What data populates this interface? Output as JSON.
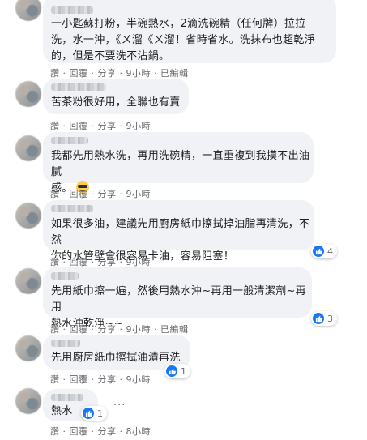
{
  "comments": [
    {
      "text": "一小匙蘇打粉，半碗熱水，2滴洗碗精（任何牌）拉拉\n洗，水一沖，《ㄨ溜《ㄨ溜！省時省水。洗抹布也超乾淨\n的，但是不要洗不沾鍋。",
      "actions": {
        "like": "讚",
        "reply": "回覆",
        "share": "分享",
        "time": "9小時",
        "edited": "已編輯"
      }
    },
    {
      "text": "苦茶粉很好用，全聯也有賣",
      "actions": {
        "like": "讚",
        "reply": "回覆",
        "share": "分享",
        "time": "9小時"
      }
    },
    {
      "text": "我都先用熱水洗，再用洗碗精，一直重複到我摸不出油膩\n感。",
      "emoji": "sunglasses-emoji",
      "actions": {
        "like": "讚",
        "reply": "回覆",
        "share": "分享",
        "time": "9小時"
      }
    },
    {
      "text": "如果很多油，建議先用廚房紙巾擦拭掉油脂再清洗，不然\n你的水管壁會很容易卡油，容易阻塞！",
      "reaction_count": "4",
      "actions": {
        "like": "讚",
        "reply": "回覆",
        "share": "分享",
        "time": "9小時"
      }
    },
    {
      "text": "先用紙巾擦一遍，然後用熱水沖~再用一般清潔劑~再用\n熱水沖乾淨~~",
      "reaction_count": "3",
      "actions": {
        "like": "讚",
        "reply": "回覆",
        "share": "分享",
        "time": "9小時",
        "edited": "已編輯"
      }
    },
    {
      "text": "先用廚房紙巾擦拭油漬再洗",
      "reaction_count": "1",
      "actions": {
        "like": "讚",
        "reply": "回覆",
        "share": "分享",
        "time": "9小時"
      }
    },
    {
      "text": "熱水",
      "reaction_count": "1",
      "more_dots": "···",
      "actions": {
        "like": "讚",
        "reply": "回覆",
        "share": "分享",
        "time": "8小時"
      }
    }
  ],
  "separator": " · ",
  "colors": {
    "bubble": "#f0f2f5",
    "meta": "#65676b",
    "like_blue": "#1877f2"
  }
}
